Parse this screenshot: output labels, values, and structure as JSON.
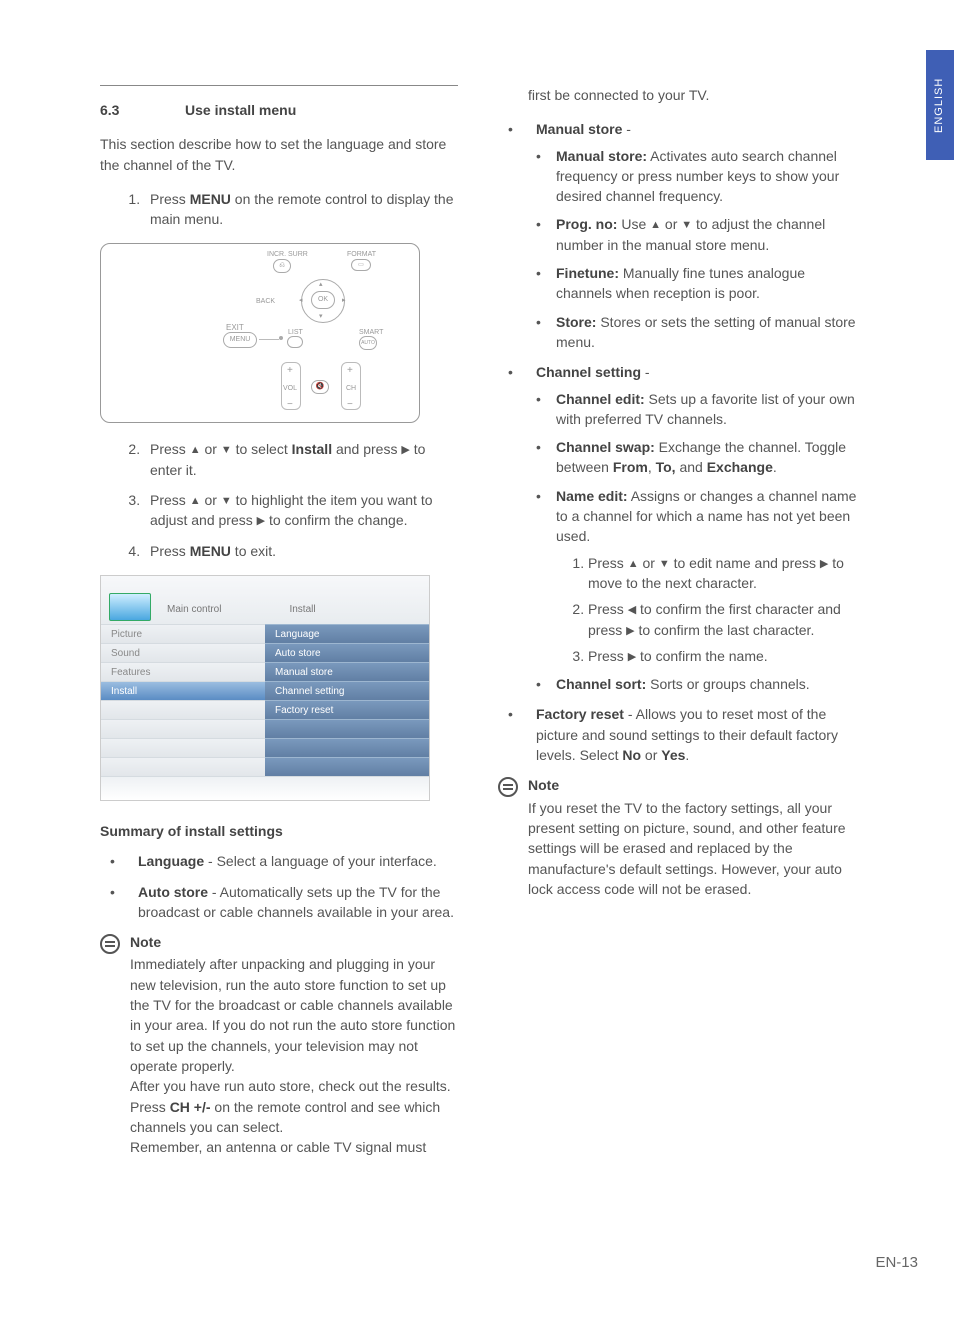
{
  "lang_tab": "ENGLISH",
  "page_number": "EN-13",
  "section": {
    "num": "6.3",
    "title": "Use install menu"
  },
  "intro": "This section describe how to set the language and store the channel of the TV.",
  "steps": {
    "s1a": "Press ",
    "s1b": "MENU",
    "s1c": " on the remote control to display the main menu.",
    "s2a": "Press ",
    "s2b": " or ",
    "s2c": " to select ",
    "s2d": "Install",
    "s2e": " and press ",
    "s2f": " to enter it.",
    "s3a": "Press ",
    "s3b": " or ",
    "s3c": " to highlight the item you want to adjust and press ",
    "s3d": " to confirm the change.",
    "s4a": "Press ",
    "s4b": "MENU",
    "s4c": " to exit."
  },
  "remote": {
    "incr": "INCR. SURR",
    "format": "FORMAT",
    "back": "BACK",
    "ok": "OK",
    "exit": "EXIT",
    "menu": "MENU",
    "list": "LIST",
    "smart": "SMART",
    "auto": "AUTO",
    "vol": "VOL",
    "ch": "CH",
    "plus": "+",
    "minus": "−"
  },
  "menu_fig": {
    "tab_main": "Main control",
    "tab_install": "Install",
    "left": [
      "Picture",
      "Sound",
      "Features",
      "Install",
      "",
      "",
      "",
      ""
    ],
    "left_selected_index": 3,
    "right": [
      "Language",
      "Auto store",
      "Manual store",
      "Channel setting",
      "Factory reset",
      "",
      "",
      ""
    ]
  },
  "summary": {
    "heading": "Summary of install settings",
    "language_b": "Language",
    "language_t": " - Select a language of your interface.",
    "auto_b": "Auto store",
    "auto_t": " - Automatically sets up the TV for the broadcast or cable channels available in your area."
  },
  "note1": {
    "title": "Note",
    "p1": "Immediately after unpacking and plugging in your new television, run the auto store function to set up the TV for the broadcast or cable channels available in your area.  If you do not run the auto store function to set up the channels, your television may not operate properly.",
    "p2a": "After you have run auto store, check out the results.  Press ",
    "p2b": "CH +/-",
    "p2c": " on the remote control and see which channels you can select.",
    "p3": "Remember, an antenna or cable TV signal must"
  },
  "col2": {
    "cont": "first be connected to your TV.",
    "manual_head": "Manual store",
    "manual": {
      "ms_b": "Manual store:",
      "ms_t": " Activates auto search channel frequency or press number keys to show your desired channel frequency.",
      "pn_b": "Prog. no:",
      "pn_t1": " Use ",
      "pn_t2": " or ",
      "pn_t3": " to adjust the channel number in the manual store menu.",
      "ft_b": "Finetune:",
      "ft_t": " Manually fine tunes analogue channels when reception is poor.",
      "st_b": "Store:",
      "st_t": " Stores or sets the setting of manual store menu."
    },
    "cs_head": "Channel setting",
    "cs": {
      "ce_b": "Channel edit:",
      "ce_t": " Sets up a favorite list of your own with preferred TV channels.",
      "sw_b": "Channel swap:",
      "sw_t1": " Exchange the channel.  Toggle between ",
      "sw_from": "From",
      "sw_c1": ", ",
      "sw_to": "To,",
      "sw_c2": " and ",
      "sw_ex": "Exchange",
      "sw_end": ".",
      "ne_b": "Name edit:",
      "ne_t": " Assigns or changes a channel name to a channel for which a name has not yet been used.",
      "ne1a": "Press ",
      "ne1b": " or ",
      "ne1c": " to edit name and press ",
      "ne1d": " to move to the next character.",
      "ne2a": "Press ",
      "ne2b": "  to confirm the first character and press  ",
      "ne2c": " to confirm the last character.",
      "ne3a": "Press  ",
      "ne3b": " to confirm the name.",
      "so_b": "Channel sort:",
      "so_t": " Sorts or groups channels."
    },
    "fr_b": "Factory reset",
    "fr_t1": " - Allows you to reset most of the picture and sound settings to their default factory levels.  Select ",
    "fr_no": "No",
    "fr_or": " or ",
    "fr_yes": "Yes",
    "fr_end": "."
  },
  "note2": {
    "title": "Note",
    "body": "If you reset the TV to the factory settings, all your present setting on picture, sound, and other feature settings will be erased and replaced by the manufacture's default settings.  However, your auto lock access code will not be erased."
  }
}
